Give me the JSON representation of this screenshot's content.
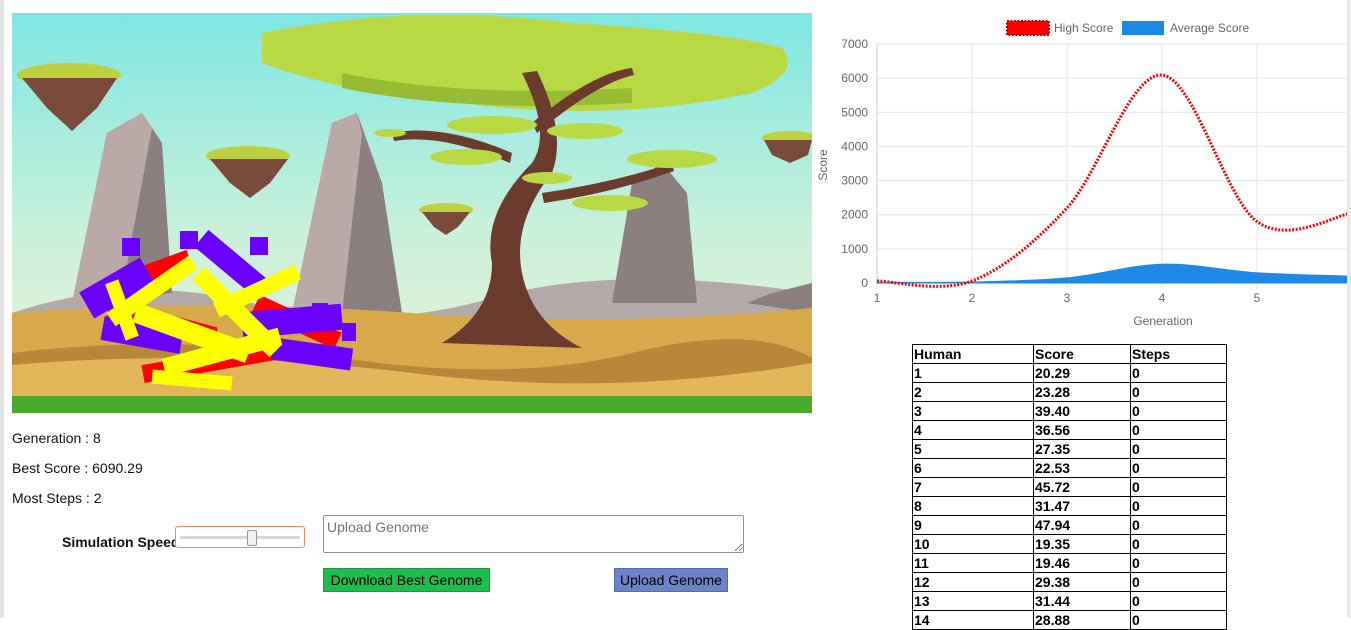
{
  "stats": {
    "generation": "Generation : 8",
    "best_score": "Best Score : 6090.29",
    "most_steps": "Most Steps : 2"
  },
  "controls": {
    "speed_label": "Simulation Speed",
    "speed_value_fraction": 0.6,
    "genome_placeholder": "Upload Genome",
    "download_label": "Download Best Genome",
    "upload_label": "Upload Genome"
  },
  "colors": {
    "high_score": "#ff0000",
    "average_score": "#1e88e5",
    "download_button": "#1cbe4d",
    "upload_button": "#6c83cb",
    "creature_a": "#ffff00",
    "creature_b": "#6a00ff",
    "creature_c": "#ff0000"
  },
  "chart_data": {
    "type": "line",
    "xlabel": "Generation",
    "ylabel": "Score",
    "x": [
      1,
      2,
      3,
      4,
      5,
      6
    ],
    "ylim": [
      0,
      7000
    ],
    "yticks": [
      0,
      1000,
      2000,
      3000,
      4000,
      5000,
      6000,
      7000
    ],
    "xticks": [
      1,
      2,
      3,
      4,
      5
    ],
    "legend_position": "top",
    "grid": true,
    "series": [
      {
        "name": "High Score",
        "values": [
          60,
          60,
          2200,
          6090,
          1800,
          2050
        ],
        "style": "dotted-line"
      },
      {
        "name": "Average Score",
        "values": [
          20,
          30,
          150,
          550,
          300,
          200
        ],
        "style": "filled-area"
      }
    ]
  },
  "table": {
    "headers": [
      "Human",
      "Score",
      "Steps"
    ],
    "rows": [
      [
        "1",
        "20.29",
        "0"
      ],
      [
        "2",
        "23.28",
        "0"
      ],
      [
        "3",
        "39.40",
        "0"
      ],
      [
        "4",
        "36.56",
        "0"
      ],
      [
        "5",
        "27.35",
        "0"
      ],
      [
        "6",
        "22.53",
        "0"
      ],
      [
        "7",
        "45.72",
        "0"
      ],
      [
        "8",
        "31.47",
        "0"
      ],
      [
        "9",
        "47.94",
        "0"
      ],
      [
        "10",
        "19.35",
        "0"
      ],
      [
        "11",
        "19.46",
        "0"
      ],
      [
        "12",
        "29.38",
        "0"
      ],
      [
        "13",
        "31.44",
        "0"
      ],
      [
        "14",
        "28.88",
        "0"
      ]
    ]
  }
}
